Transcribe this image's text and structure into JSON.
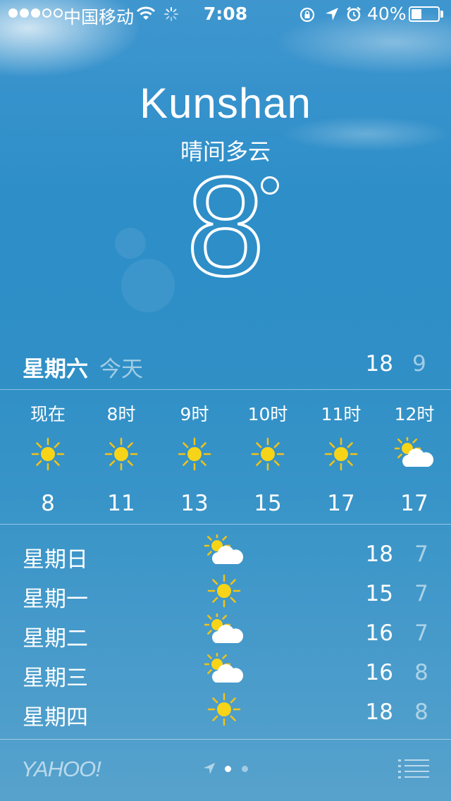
{
  "status_bar": {
    "carrier": "中国移动",
    "time": "7:08",
    "battery_percent": "40%",
    "battery_level": 0.4,
    "signal_bars_filled": 3,
    "signal_bars_total": 5
  },
  "location": {
    "city": "Kunshan",
    "condition": "晴间多云",
    "temperature": "8"
  },
  "today": {
    "day": "星期六",
    "label": "今天",
    "high": "18",
    "low": "9"
  },
  "hourly": [
    {
      "time": "现在",
      "icon": "sun-icon",
      "temp": "8"
    },
    {
      "time": "8时",
      "icon": "sun-icon",
      "temp": "11"
    },
    {
      "time": "9时",
      "icon": "sun-icon",
      "temp": "13"
    },
    {
      "time": "10时",
      "icon": "sun-icon",
      "temp": "15"
    },
    {
      "time": "11时",
      "icon": "sun-icon",
      "temp": "17"
    },
    {
      "time": "12时",
      "icon": "partly-cloudy-icon",
      "temp": "17"
    }
  ],
  "daily": [
    {
      "day": "星期日",
      "icon": "partly-cloudy-icon",
      "high": "18",
      "low": "7"
    },
    {
      "day": "星期一",
      "icon": "sun-icon",
      "high": "15",
      "low": "7"
    },
    {
      "day": "星期二",
      "icon": "partly-cloudy-icon",
      "high": "16",
      "low": "7"
    },
    {
      "day": "星期三",
      "icon": "partly-cloudy-icon",
      "high": "16",
      "low": "8"
    },
    {
      "day": "星期四",
      "icon": "sun-icon",
      "high": "18",
      "low": "8"
    }
  ],
  "footer": {
    "provider": "YAHOO!",
    "pages_total": 2,
    "current_page": 1
  },
  "colors": {
    "sun": "#f7d417",
    "sun_rays": "#f2c316",
    "cloud": "#ffffff"
  }
}
